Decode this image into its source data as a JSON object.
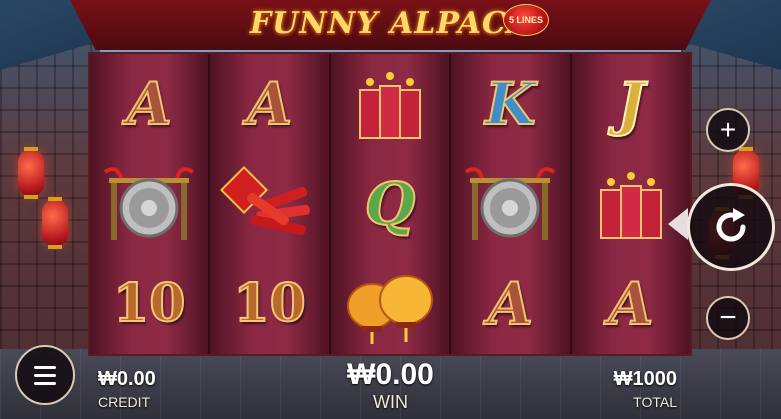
{
  "game": {
    "title": "FUNNY ALPACA",
    "lines_badge": "5 LINES"
  },
  "reels": [
    [
      "A",
      "gong",
      "10"
    ],
    [
      "A",
      "firecrackers",
      "10"
    ],
    [
      "firework-bundle",
      "Q",
      "lanterns"
    ],
    [
      "K",
      "gong",
      "A"
    ],
    [
      "J",
      "firework-bundle",
      "A"
    ]
  ],
  "controls": {
    "bet_increase": "+",
    "bet_decrease": "−",
    "spin_icon": "refresh-arrow-icon",
    "menu_icon": "hamburger-menu-icon"
  },
  "stats": {
    "credit_value": "₩0.00",
    "credit_label": "CREDIT",
    "win_value": "₩0.00",
    "win_label": "WIN",
    "total_value": "₩1000",
    "total_label": "TOTAL"
  },
  "colors": {
    "title_gold": "#ffd96a",
    "reel_maroon": "#8a2843",
    "frame_dark": "#2e0a12",
    "button_border": "#d9cbb0"
  }
}
